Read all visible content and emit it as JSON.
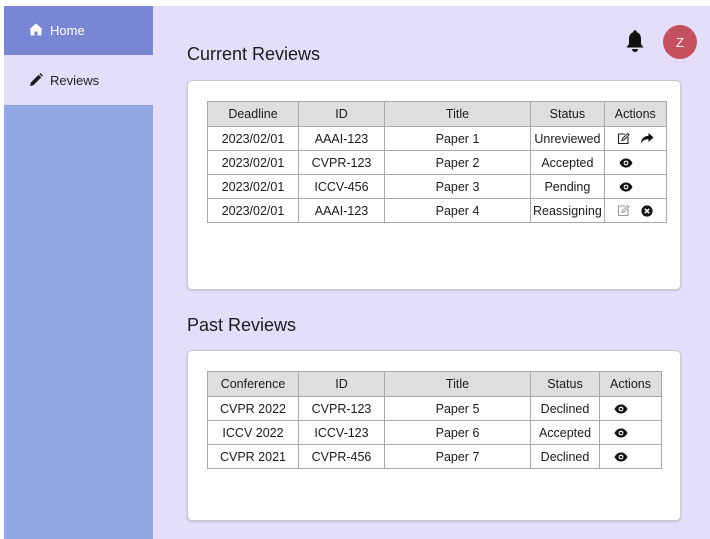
{
  "sidebar": {
    "items": [
      {
        "label": "Home",
        "icon": "home-icon"
      },
      {
        "label": "Reviews",
        "icon": "pencil-icon"
      }
    ]
  },
  "header": {
    "avatar_initial": "Z",
    "bell_icon": "bell-icon"
  },
  "current": {
    "title": "Current Reviews",
    "columns": [
      "Deadline",
      "ID",
      "Title",
      "Status",
      "Actions"
    ],
    "rows": [
      {
        "deadline": "2023/02/01",
        "id": "AAAI-123",
        "title": "Paper 1",
        "status": "Unreviewed",
        "actions": [
          "edit-icon",
          "forward-icon"
        ]
      },
      {
        "deadline": "2023/02/01",
        "id": "CVPR-123",
        "title": "Paper 2",
        "status": "Accepted",
        "actions": [
          "eye-icon"
        ]
      },
      {
        "deadline": "2023/02/01",
        "id": "ICCV-456",
        "title": "Paper 3",
        "status": "Pending",
        "actions": [
          "eye-icon"
        ]
      },
      {
        "deadline": "2023/02/01",
        "id": "AAAI-123",
        "title": "Paper 4",
        "status": "Reassigning",
        "actions": [
          "edit-icon-disabled",
          "cancel-icon"
        ]
      }
    ]
  },
  "past": {
    "title": "Past Reviews",
    "columns": [
      "Conference",
      "ID",
      "Title",
      "Status",
      "Actions"
    ],
    "rows": [
      {
        "conference": "CVPR 2022",
        "id": "CVPR-123",
        "title": "Paper 5",
        "status": "Declined",
        "actions": [
          "eye-icon"
        ]
      },
      {
        "conference": "ICCV 2022",
        "id": "ICCV-123",
        "title": "Paper 6",
        "status": "Accepted",
        "actions": [
          "eye-icon"
        ]
      },
      {
        "conference": "CVPR 2021",
        "id": "CVPR-456",
        "title": "Paper 7",
        "status": "Declined",
        "actions": [
          "eye-icon"
        ]
      }
    ]
  },
  "colors": {
    "sidebar": "#93a7e6",
    "sidebar_active": "#7986d4",
    "background": "#e4defc",
    "avatar": "#c5505f"
  }
}
